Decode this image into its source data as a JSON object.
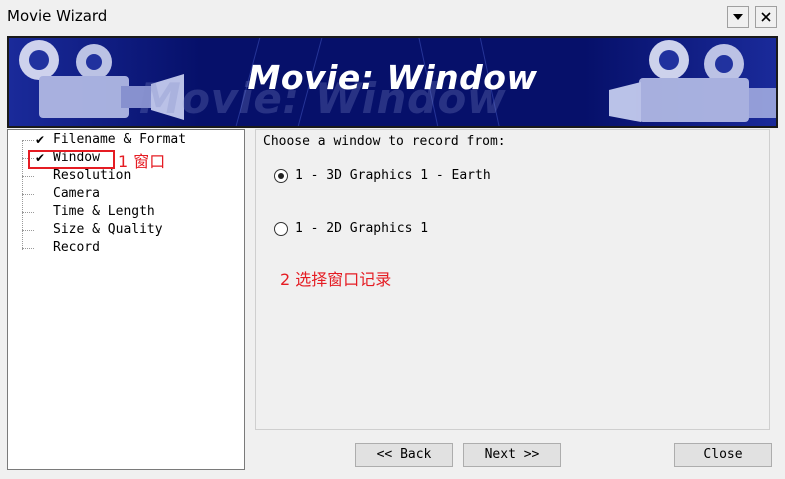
{
  "window": {
    "title": "Movie Wizard"
  },
  "banner": {
    "title": "Movie: Window"
  },
  "tree": {
    "items": [
      {
        "label": "Filename & Format",
        "checked": true
      },
      {
        "label": "Window",
        "checked": true
      },
      {
        "label": "Resolution",
        "checked": false
      },
      {
        "label": "Camera",
        "checked": false
      },
      {
        "label": "Time & Length",
        "checked": false
      },
      {
        "label": "Size & Quality",
        "checked": false
      },
      {
        "label": "Record",
        "checked": false
      }
    ]
  },
  "annotations": {
    "step1": "1 窗口",
    "step2": "2 选择窗口记录"
  },
  "panel": {
    "prompt": "Choose a window to record from:",
    "options": [
      {
        "label": "1 - 3D Graphics 1 - Earth",
        "selected": true
      },
      {
        "label": "1 - 2D Graphics 1",
        "selected": false
      }
    ]
  },
  "buttons": {
    "back": "<< Back",
    "next": "Next >>",
    "close": "Close"
  },
  "colors": {
    "banner_bg": "#08106e",
    "annotation": "#e51c23"
  }
}
